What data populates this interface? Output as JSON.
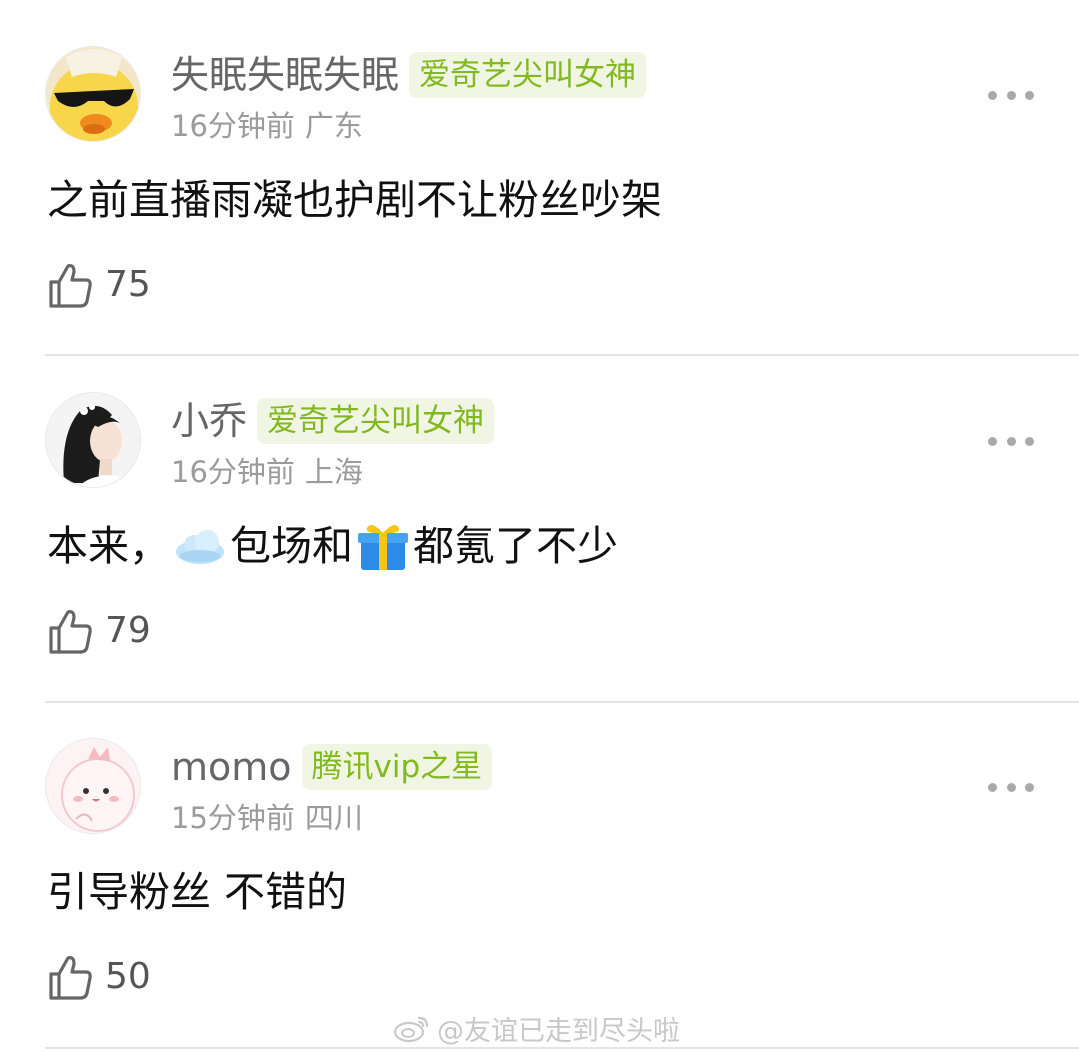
{
  "comments": [
    {
      "username": "失眠失眠失眠",
      "badge": "爱奇艺尖叫女神",
      "time": "16分钟前",
      "location": "广东",
      "text": "之前直播雨凝也护剧不让粉丝吵架",
      "likes": "75",
      "avatar_icon": "duck-with-sunglasses-avatar"
    },
    {
      "username": "小乔",
      "badge": "爱奇艺尖叫女神",
      "time": "16分钟前",
      "location": "上海",
      "text_before": "本来，",
      "text_mid": "包场和",
      "text_after": "都氪了不少",
      "emoji_1": "cloud-emoji",
      "emoji_2": "gift-emoji",
      "likes": "79",
      "avatar_icon": "woman-portrait-avatar"
    },
    {
      "username": "momo",
      "badge": "腾讯vip之星",
      "time": "15分钟前",
      "location": "四川",
      "text": "引导粉丝 不错的",
      "likes": "50",
      "avatar_icon": "pink-cartoon-avatar"
    }
  ],
  "watermark": {
    "text": "@友谊已走到尽头啦",
    "icon": "weibo-logo-icon"
  },
  "colors": {
    "badge_text": "#82b91e",
    "badge_bg": "#f1f6e4",
    "meta_text": "#9b9b9b",
    "divider": "#e4e4e4"
  }
}
